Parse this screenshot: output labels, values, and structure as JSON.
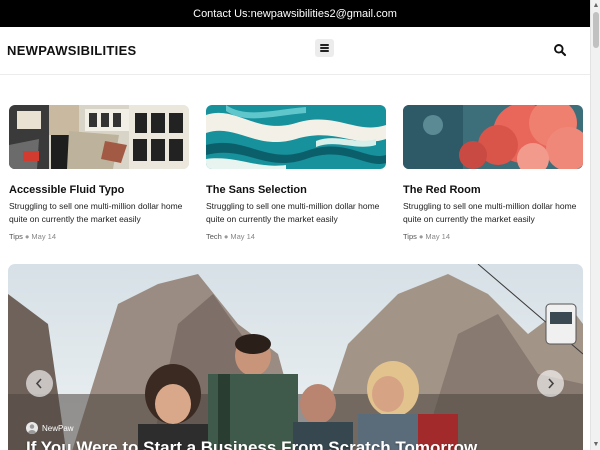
{
  "topbar": {
    "contact_text": "Contact Us:newpawsibilities2@gmail.com"
  },
  "header": {
    "logo": "NEWPAWSIBILITIES",
    "menu_icon": "hamburger-menu-icon",
    "search_icon": "search-icon"
  },
  "cards": [
    {
      "title": "Accessible Fluid Typo",
      "excerpt": "Struggling to sell one multi-million dollar home quite on currently the market easily",
      "category": "Tips",
      "date": "May 14",
      "image": "torn-poster-collage"
    },
    {
      "title": "The Sans Selection",
      "excerpt": "Struggling to sell one multi-million dollar home quite on currently the market easily",
      "category": "Tech",
      "date": "May 14",
      "image": "teal-marble-swirl"
    },
    {
      "title": "The Red Room",
      "excerpt": "Struggling to sell one multi-million dollar home quite on currently the market easily",
      "category": "Tips",
      "date": "May 14",
      "image": "red-smoke-clouds"
    }
  ],
  "hero": {
    "author": "NewPaw",
    "title": "If You Were to Start a Business From Scratch Tomorrow",
    "image": "friends-hiking-mountains",
    "prev_icon": "chevron-left-icon",
    "next_icon": "chevron-right-icon"
  },
  "colors": {
    "topbar_bg": "#000000",
    "accent_teal": "#1aa3ae",
    "accent_red": "#e8675a"
  }
}
